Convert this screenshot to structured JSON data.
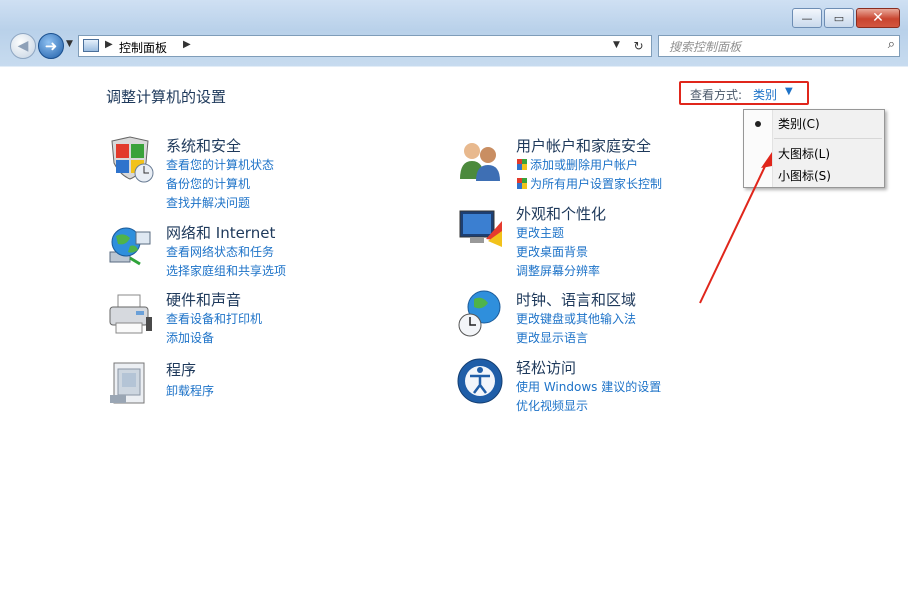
{
  "address_bar": {
    "path": "控制面板",
    "search_placeholder": "搜索控制面板"
  },
  "window_controls": {
    "minimize": "—",
    "maximize": "▭",
    "close": "✕"
  },
  "page": {
    "title": "调整计算机的设置"
  },
  "view_by": {
    "label": "查看方式:",
    "value": "类别",
    "menu": [
      {
        "label": "类别(C)",
        "selected": true
      },
      {
        "label": "大图标(L)",
        "selected": false
      },
      {
        "label": "小图标(S)",
        "selected": false
      }
    ]
  },
  "categories_left": [
    {
      "title": "系统和安全",
      "icon": "shield-icon",
      "links": [
        "查看您的计算机状态",
        "备份您的计算机",
        "查找并解决问题"
      ]
    },
    {
      "title": "网络和 Internet",
      "icon": "network-globe-icon",
      "links": [
        "查看网络状态和任务",
        "选择家庭组和共享选项"
      ]
    },
    {
      "title": "硬件和声音",
      "icon": "printer-icon",
      "links": [
        "查看设备和打印机",
        "添加设备"
      ]
    },
    {
      "title": "程序",
      "icon": "programs-icon",
      "links": [
        "卸载程序"
      ]
    }
  ],
  "categories_right": [
    {
      "title": "用户帐户和家庭安全",
      "icon": "users-icon",
      "links": [
        "添加或删除用户帐户",
        "为所有用户设置家长控制"
      ]
    },
    {
      "title": "外观和个性化",
      "icon": "appearance-icon",
      "links": [
        "更改主题",
        "更改桌面背景",
        "调整屏幕分辨率"
      ]
    },
    {
      "title": "时钟、语言和区域",
      "icon": "clock-globe-icon",
      "links": [
        "更改键盘或其他输入法",
        "更改显示语言"
      ]
    },
    {
      "title": "轻松访问",
      "icon": "ease-of-access-icon",
      "links": [
        "使用 Windows 建议的设置",
        "优化视频显示"
      ]
    }
  ],
  "colors": {
    "link": "#1e73c8",
    "heading": "#1e395b",
    "highlight_border": "#e0261b"
  }
}
